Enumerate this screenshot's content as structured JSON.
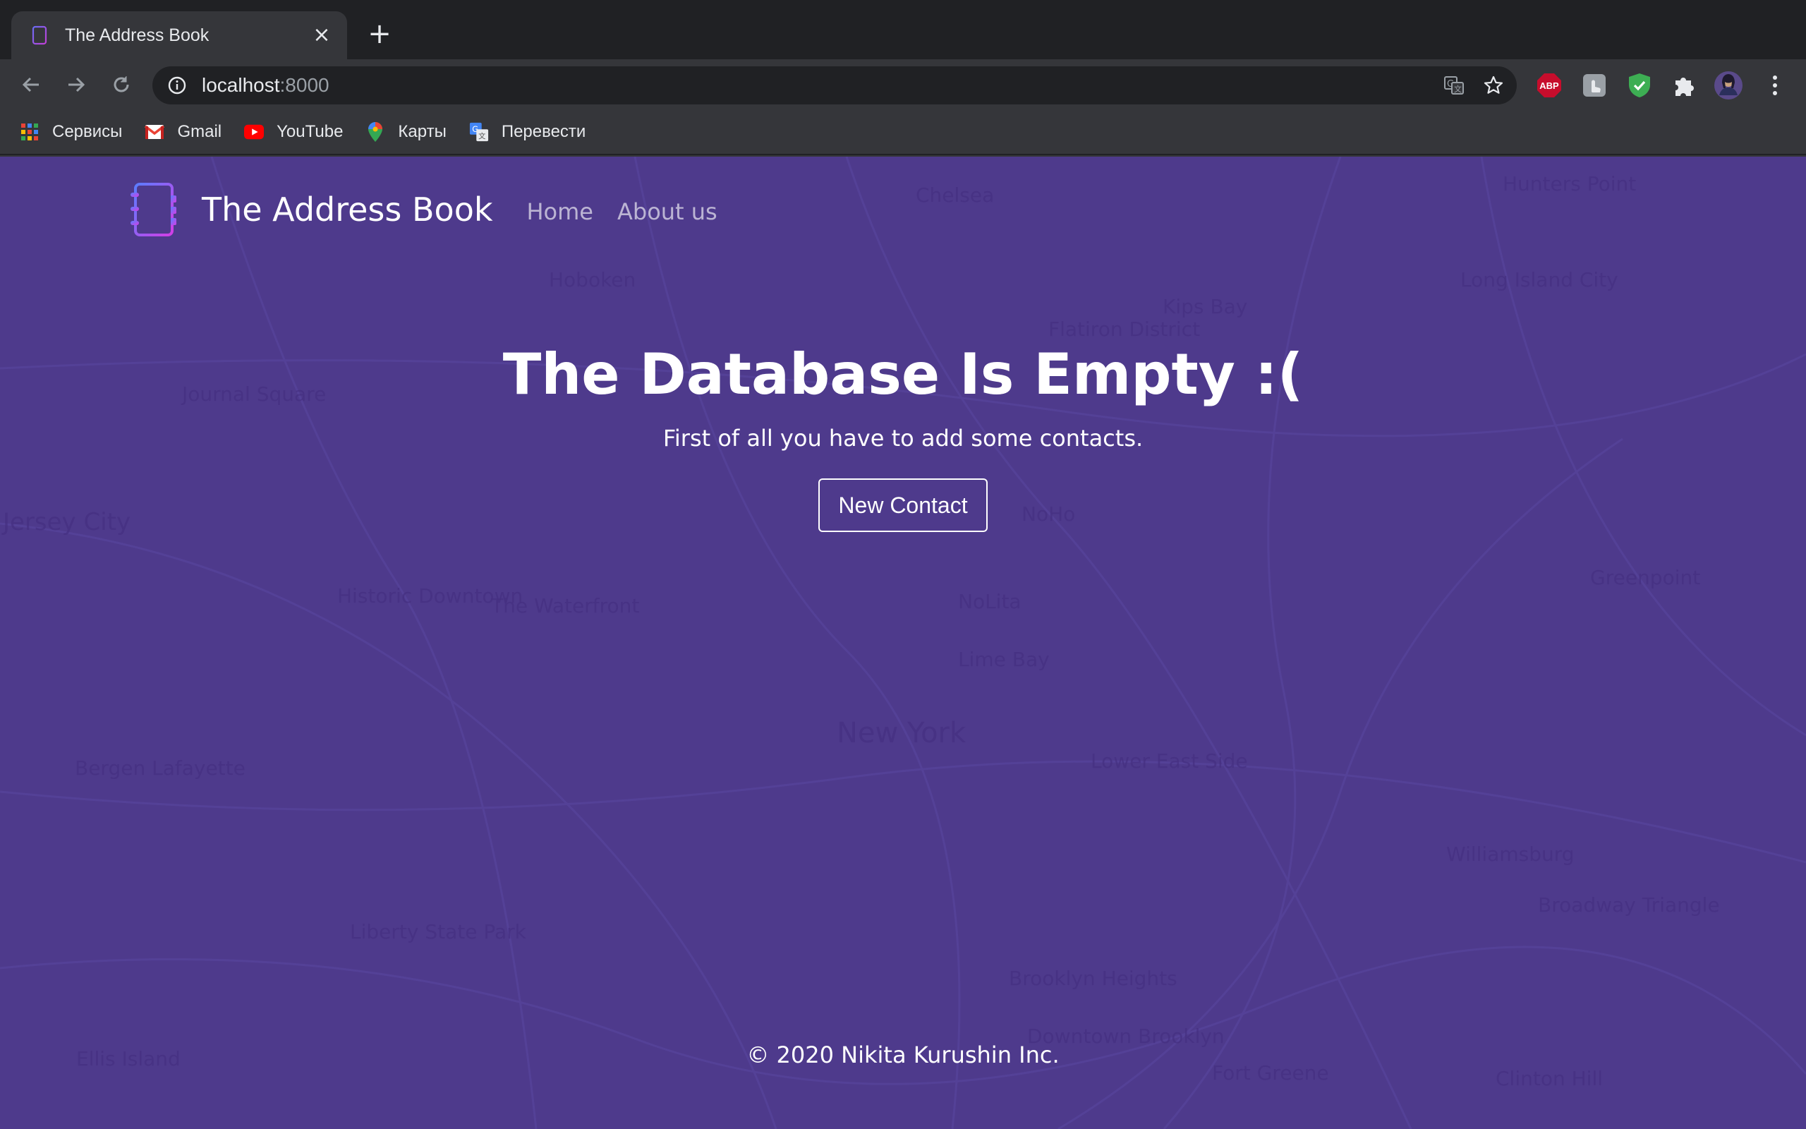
{
  "browser": {
    "tab_title": "The Address Book",
    "tab_close_icon": "close-icon",
    "new_tab_icon": "plus-icon",
    "url_host": "localhost",
    "url_port": ":8000",
    "bookmarks": [
      {
        "label": "Сервисы",
        "icon": "apps-grid-icon"
      },
      {
        "label": "Gmail",
        "icon": "gmail-icon"
      },
      {
        "label": "YouTube",
        "icon": "youtube-icon"
      },
      {
        "label": "Карты",
        "icon": "maps-pin-icon"
      },
      {
        "label": "Перевести",
        "icon": "translate-icon"
      }
    ],
    "extensions": [
      {
        "label": "ABP",
        "icon": "adblock-plus-icon"
      },
      {
        "icon": "touch-extension-icon"
      },
      {
        "icon": "shield-check-icon"
      },
      {
        "icon": "puzzle-extensions-icon"
      },
      {
        "icon": "profile-avatar-icon"
      },
      {
        "icon": "kebab-menu-icon"
      }
    ]
  },
  "site": {
    "brand_name": "The Address Book",
    "nav": {
      "home": "Home",
      "about": "About us"
    },
    "hero_title": "The Database Is Empty :(",
    "hero_subtitle": "First of all you have to add some contacts.",
    "cta_label": "New Contact",
    "footer": "© 2020 Nikita Kurushin Inc."
  },
  "map_labels": [
    "Chelsea",
    "Hoboken",
    "Hunters Point",
    "Long Island City",
    "Kips Bay",
    "Flatiron District",
    "Journal Square",
    "Jersey City",
    "Historic Downtown",
    "The Waterfront",
    "NoHo",
    "NoLita",
    "Lime Bay",
    "New York",
    "Lower East Side",
    "Greenpoint",
    "Bergen Lafayette",
    "Williamsburg",
    "Broadway Triangle",
    "Brooklyn Heights",
    "Downtown Brooklyn",
    "Fort Greene",
    "Liberty State Park",
    "Clinton Hill",
    "Ellis Island"
  ],
  "colors": {
    "page_bg": "#4e3a8c",
    "chrome_dark": "#202124",
    "chrome": "#35363a"
  }
}
